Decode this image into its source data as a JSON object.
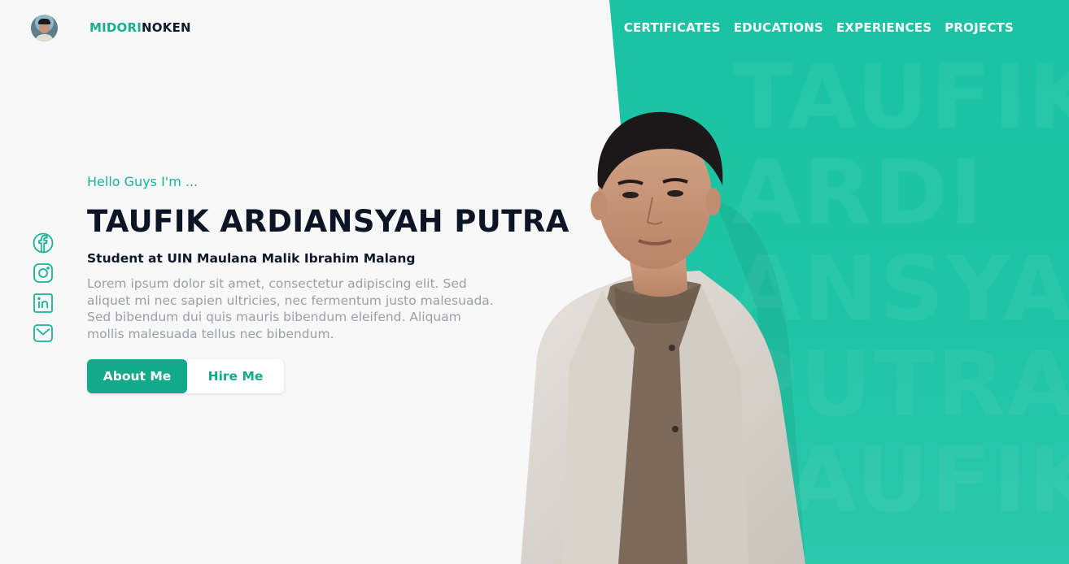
{
  "brand": {
    "logo_part1": "MIDORI",
    "logo_part2": "NOKEN"
  },
  "nav": {
    "items": [
      "CERTIFICATES",
      "EDUCATIONS",
      "EXPERIENCES",
      "PROJECTS"
    ]
  },
  "social": {
    "icons": [
      "facebook-icon",
      "instagram-icon",
      "linkedin-icon",
      "mail-icon"
    ]
  },
  "hero": {
    "greeting": "Hello Guys I'm ...",
    "name": "TAUFIK ARDIANSYAH PUTRA",
    "subtitle": "Student at UIN Maulana Malik Ibrahim Malang",
    "description": "Lorem ipsum dolor sit amet, consectetur adipiscing elit. Sed aliquet mi nec sapien ultricies, nec fermentum justo malesuada. Sed bibendum dui quis mauris bibendum eleifend. Aliquam mollis malesuada tellus nec bibendum.",
    "primary_button": "About Me",
    "secondary_button": "Hire Me"
  },
  "colors": {
    "accent": "#13aa8c",
    "teal_panel": "#1ec4a5",
    "background": "#f8f8f9",
    "text_dark": "#0c1526",
    "text_muted": "#9a9ea6"
  }
}
